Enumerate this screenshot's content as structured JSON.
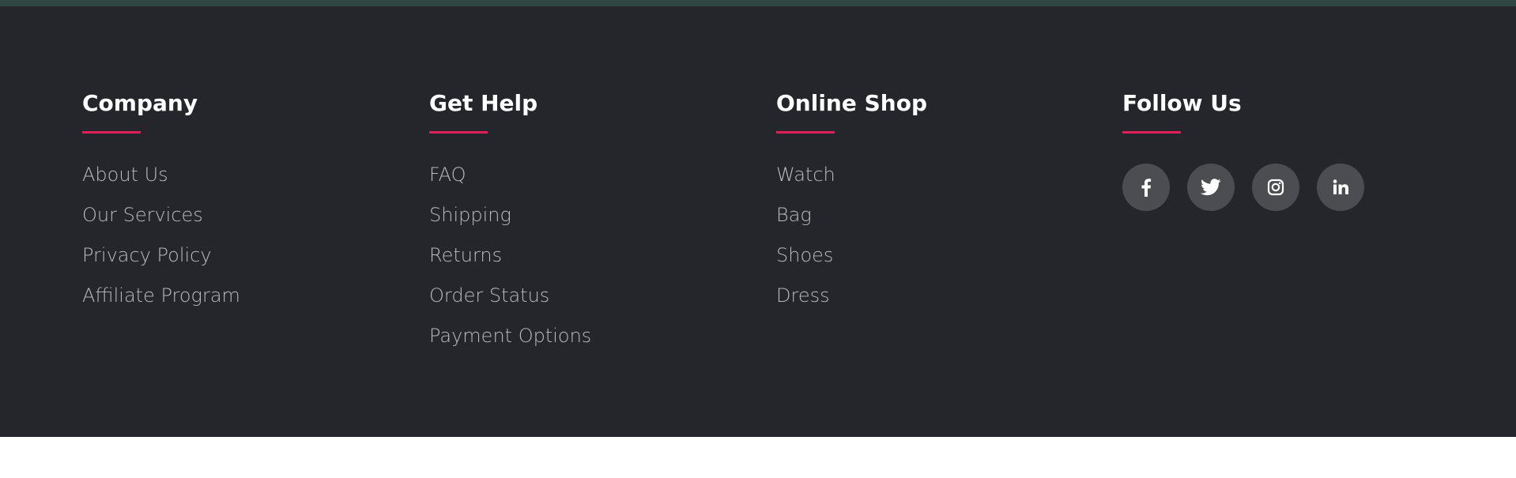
{
  "columns": [
    {
      "title": "Company",
      "links": [
        "About Us",
        "Our Services",
        "Privacy Policy",
        "Affiliate Program"
      ]
    },
    {
      "title": "Get Help",
      "links": [
        "FAQ",
        "Shipping",
        "Returns",
        "Order Status",
        "Payment Options"
      ]
    },
    {
      "title": "Online Shop",
      "links": [
        "Watch",
        "Bag",
        "Shoes",
        "Dress"
      ]
    }
  ],
  "follow": {
    "title": "Follow Us",
    "icons": [
      "facebook-icon",
      "twitter-icon",
      "instagram-icon",
      "linkedin-icon"
    ]
  },
  "colors": {
    "footer_bg": "#24262b",
    "accent": "#e01e5a",
    "heading": "#ffffff",
    "link": "#bbbbbb",
    "social_bg": "#4c4d51"
  }
}
